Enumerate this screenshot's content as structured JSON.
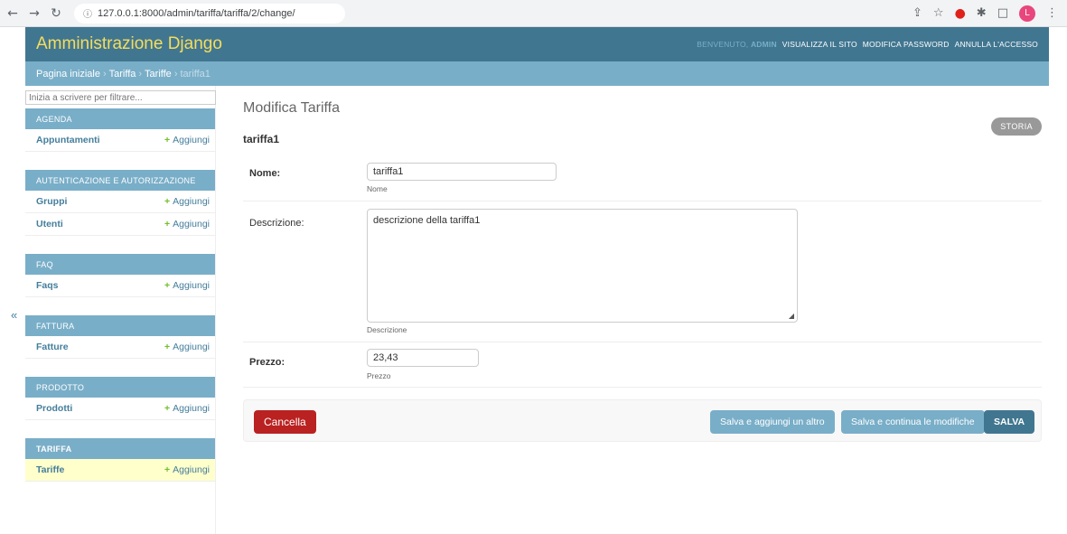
{
  "browser": {
    "url": "127.0.0.1:8000/admin/tariffa/tariffa/2/change/",
    "profile_initial": "L"
  },
  "header": {
    "brand": "Amministrazione Django",
    "welcome": "BENVENUTO,",
    "username": "ADMIN",
    "links": [
      "VISUALIZZA IL SITO",
      "MODIFICA PASSWORD",
      "ANNULLA L'ACCESSO"
    ]
  },
  "breadcrumbs": {
    "items": [
      "Pagina iniziale",
      "Tariffa",
      "Tariffe"
    ],
    "current": "tariffa1",
    "separator": "›"
  },
  "sidebar": {
    "filter_placeholder": "Inizia a scrivere per filtrare...",
    "add_label": "Aggiungi",
    "toggle": "«",
    "modules": [
      {
        "name": "AGENDA",
        "models": [
          "Appuntamenti"
        ]
      },
      {
        "name": "AUTENTICAZIONE E AUTORIZZAZIONE",
        "models": [
          "Gruppi",
          "Utenti"
        ]
      },
      {
        "name": "FAQ",
        "models": [
          "Faqs"
        ]
      },
      {
        "name": "FATTURA",
        "models": [
          "Fatture"
        ]
      },
      {
        "name": "PRODOTTO",
        "models": [
          "Prodotti"
        ]
      },
      {
        "name": "TARIFFA",
        "models": [
          "Tariffe"
        ]
      }
    ]
  },
  "content": {
    "title": "Modifica Tariffa",
    "object": "tariffa1",
    "history": "STORIA",
    "fields": {
      "nome": {
        "label": "Nome:",
        "value": "tariffa1",
        "help": "Nome"
      },
      "descrizione": {
        "label": "Descrizione:",
        "value": "descrizione della tariffa1",
        "help": "Descrizione"
      },
      "prezzo": {
        "label": "Prezzo:",
        "value": "23,43",
        "help": "Prezzo"
      }
    },
    "buttons": {
      "cancel": "Cancella",
      "save_add": "Salva e aggiungi un altro",
      "save_continue": "Salva e continua le modifiche",
      "save": "SALVA"
    }
  }
}
